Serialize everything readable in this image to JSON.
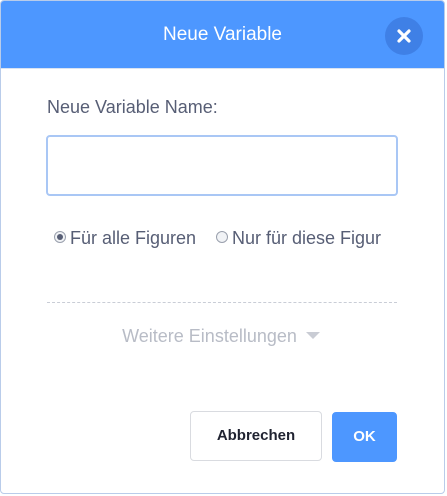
{
  "dialog": {
    "title": "Neue Variable",
    "close_icon": "close-icon",
    "name_label": "Neue Variable Name:",
    "name_value": "",
    "name_placeholder": "",
    "scope_options": [
      {
        "label": "Für alle Figuren",
        "selected": true
      },
      {
        "label": "Nur für diese Figur",
        "selected": false
      }
    ],
    "more_settings_label": "Weitere Einstellungen",
    "more_settings_icon": "caret-down-icon",
    "cancel_label": "Abbrechen",
    "ok_label": "OK"
  },
  "colors": {
    "header": "#4d97ff",
    "close_button": "#3f80e6",
    "text": "#575e75",
    "muted_text": "#b8bcc6",
    "input_border": "#a9c7f5",
    "ok_button": "#4d97ff"
  }
}
